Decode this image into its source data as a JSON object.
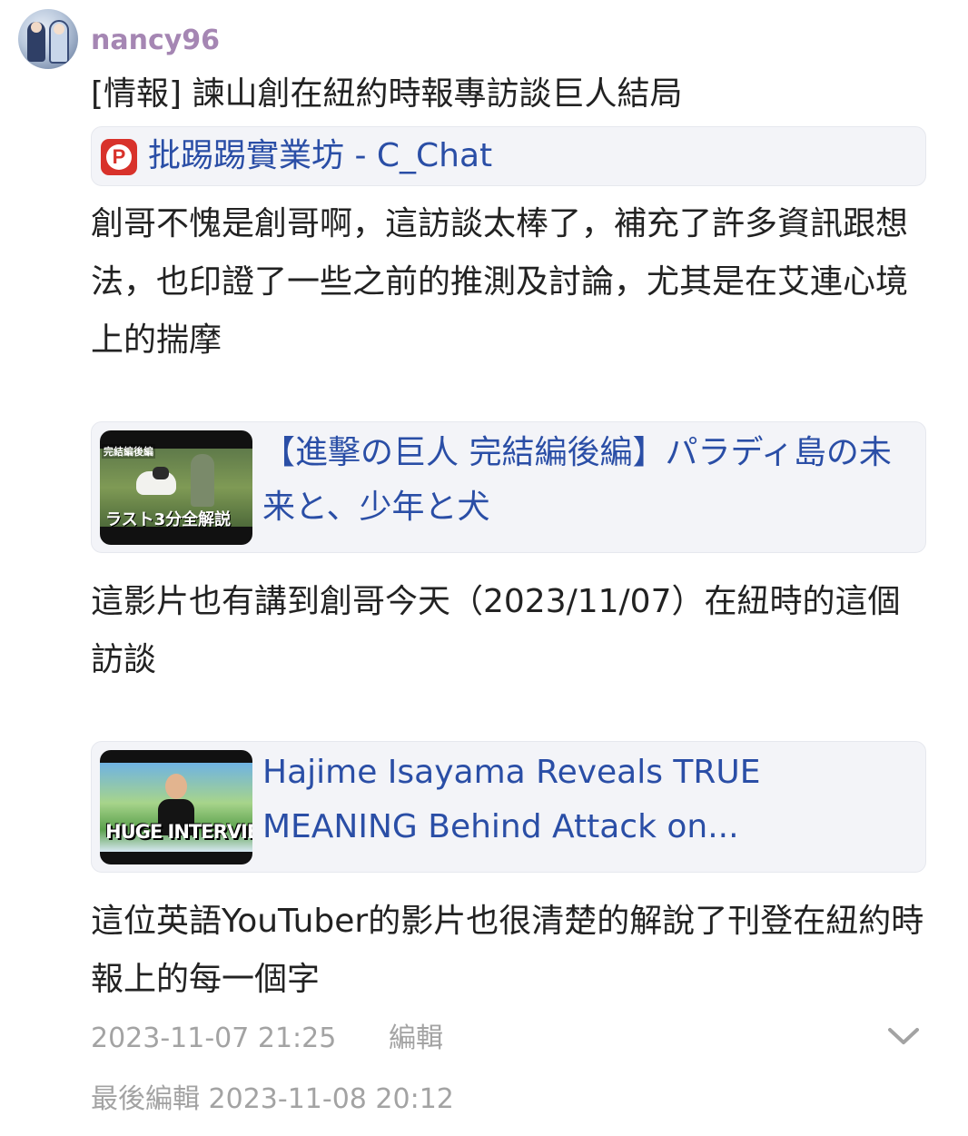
{
  "post": {
    "username": "nancy96",
    "title": "[情報] 諫山創在紐約時報專訪談巨人結局",
    "board_icon": "ptt-p-icon",
    "board_label": "批踢踢實業坊 - C_Chat",
    "paragraph1": "創哥不愧是創哥啊，這訪談太棒了，補充了許多資訊跟想法，也印證了一些之前的推測及討論，尤其是在艾連心境上的揣摩",
    "video1": {
      "title": "【進擊の巨人 完結編後編】パラディ島の未来と、少年と犬",
      "thumb_tag": "完結編後編",
      "thumb_caption": "ラスト3分全解説"
    },
    "paragraph2": "這影片也有講到創哥今天（2023/11/07）在紐時的這個訪談",
    "video2": {
      "title": "Hajime Isayama Reveals TRUE MEANING Behind Attack on...",
      "thumb_caption": "HUGE INTERVIEW"
    },
    "paragraph3": "這位英語YouTuber的影片也很清楚的解說了刊登在紐約時報上的每一個字",
    "timestamp": "2023-11-07 21:25",
    "edit_label": "編輯",
    "expand_icon": "chevron-down-icon",
    "last_edited": "最後編輯 2023-11-08 20:12"
  },
  "colors": {
    "username": "#a586b3",
    "link": "#2a4ea6",
    "meta": "#a3a3a3",
    "card_bg": "#f3f4f8"
  }
}
